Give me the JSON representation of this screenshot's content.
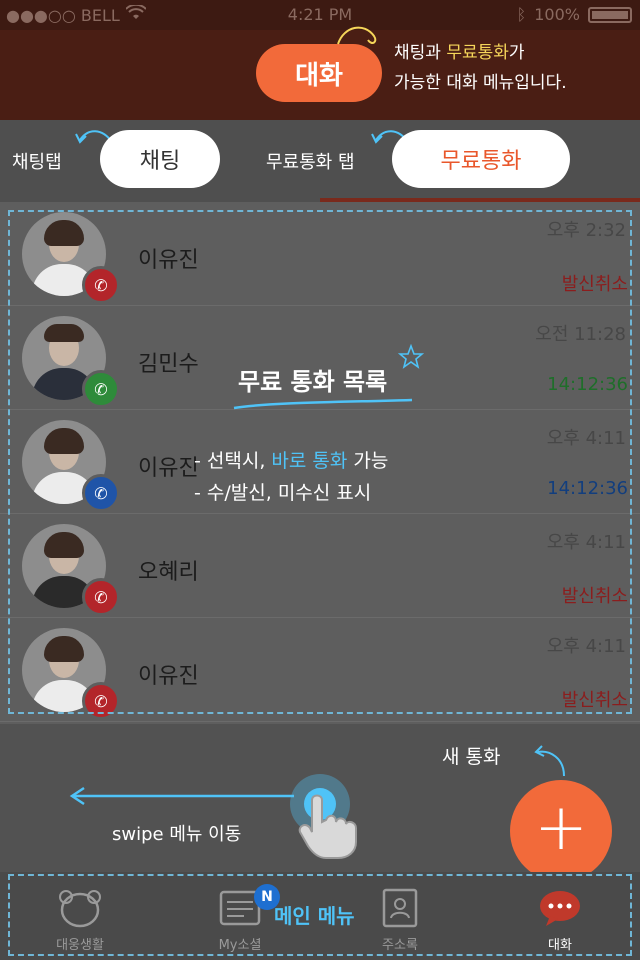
{
  "status_bar": {
    "carrier": "●●●○○ BELL",
    "time": "4:21 PM",
    "battery": "100%"
  },
  "header": {
    "title": "대화",
    "annotation_line1_pre": "채팅과 ",
    "annotation_line1_hl": "무료통화",
    "annotation_line1_post": "가",
    "annotation_line2": "가능한 대화 메뉴입니다."
  },
  "tabs": {
    "chat_label": "채팅",
    "free_call_label": "무료통화",
    "chat_tab_annotation": "채팅탭",
    "free_call_tab_annotation": "무료통화 탭"
  },
  "call_list": {
    "items": [
      {
        "name": "이유진",
        "time": "오후 2:32",
        "status": "발신취소",
        "status_color": "#8b1d1d",
        "badge_color": "#b3252a"
      },
      {
        "name": "김민수",
        "time": "오전 11:28",
        "status": "14:12:36",
        "status_color": "#1f6e2a",
        "badge_color": "#2e8b3a"
      },
      {
        "name": "이유진",
        "time": "오후 4:11",
        "status": "14:12:36",
        "status_color": "#123e7e",
        "badge_color": "#1f54a8"
      },
      {
        "name": "오혜리",
        "time": "오후 4:11",
        "status": "발신취소",
        "status_color": "#8b1d1d",
        "badge_color": "#b3252a"
      },
      {
        "name": "이유진",
        "time": "오후 4:11",
        "status": "발신취소",
        "status_color": "#8b1d1d",
        "badge_color": "#b3252a"
      }
    ],
    "overlay_title": "무료 통화 목록",
    "overlay_line1_pre": "- 선택시, ",
    "overlay_line1_hl": "바로 통화",
    "overlay_line1_post": " 가능",
    "overlay_line2": "- 수/발신, 미수신 표시"
  },
  "actions": {
    "new_call_annotation": "새 통화",
    "swipe_annotation": "swipe 메뉴 이동",
    "fab_symbol": "+"
  },
  "nav": {
    "items": [
      {
        "label": "대웅생활"
      },
      {
        "label": "My소셜",
        "badge": "N"
      },
      {
        "label": "주소록"
      },
      {
        "label": "대화"
      }
    ],
    "annotation": "메인 메뉴"
  },
  "colors": {
    "accent": "#f26a3a",
    "header_bg": "#4a1e14",
    "annotation_blue": "#4fc3f7",
    "annotation_yellow": "#f6d65a"
  }
}
